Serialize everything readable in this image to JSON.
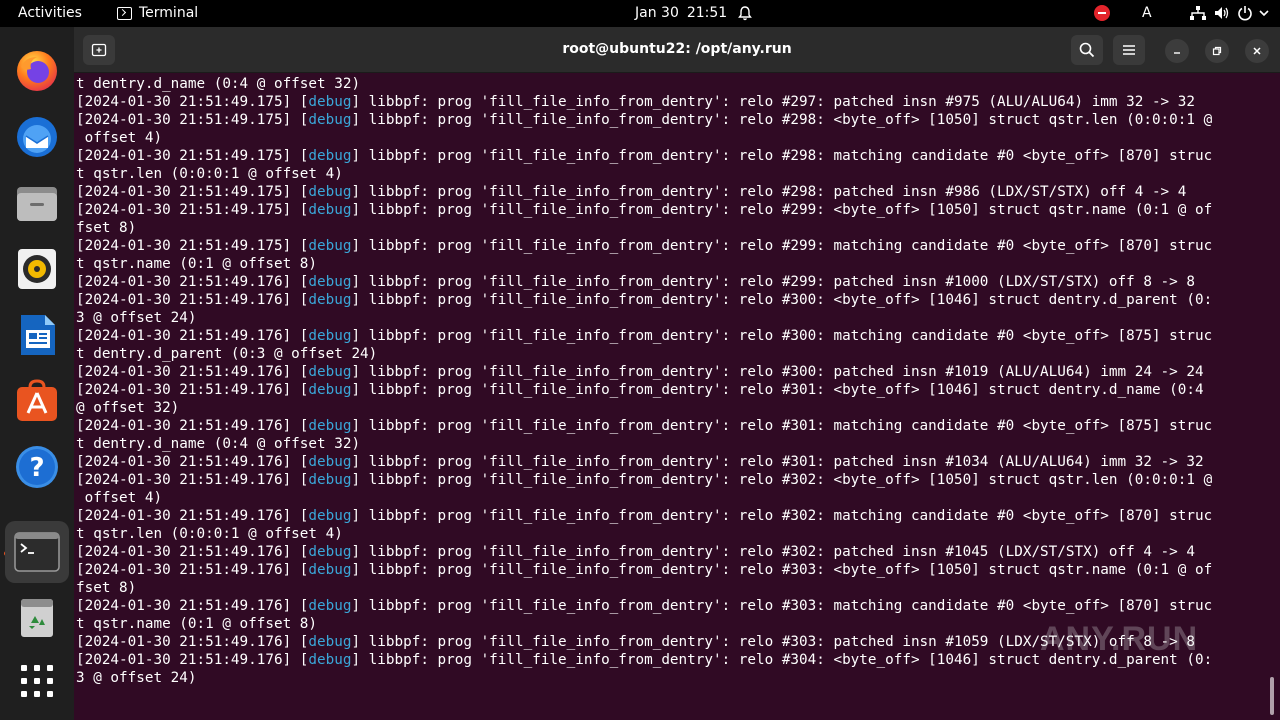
{
  "topbar": {
    "activities": "Activities",
    "app_name": "Terminal",
    "date": "Jan 30",
    "time": "21:51",
    "lang": "A"
  },
  "dock": {
    "items": [
      "firefox",
      "thunderbird",
      "files",
      "rhythmbox",
      "libreoffice-writer",
      "app-center",
      "help",
      "terminal",
      "trash",
      "show-apps"
    ]
  },
  "window": {
    "title": "root@ubuntu22: /opt/any.run"
  },
  "terminal": {
    "lines": [
      {
        "a": "t dentry.d_name (0:4 @ offset 32)"
      },
      {
        "p": "[2024-01-30 21:51:49.175] [",
        "d": "debug",
        "s": "] libbpf: prog 'fill_file_info_from_dentry': relo #297: patched insn #975 (ALU/ALU64) imm 32 -> 32"
      },
      {
        "p": "[2024-01-30 21:51:49.175] [",
        "d": "debug",
        "s": "] libbpf: prog 'fill_file_info_from_dentry': relo #298: <byte_off> [1050] struct qstr.len (0:0:0:1 @"
      },
      {
        "a": " offset 4)"
      },
      {
        "p": "[2024-01-30 21:51:49.175] [",
        "d": "debug",
        "s": "] libbpf: prog 'fill_file_info_from_dentry': relo #298: matching candidate #0 <byte_off> [870] struc"
      },
      {
        "a": "t qstr.len (0:0:0:1 @ offset 4)"
      },
      {
        "p": "[2024-01-30 21:51:49.175] [",
        "d": "debug",
        "s": "] libbpf: prog 'fill_file_info_from_dentry': relo #298: patched insn #986 (LDX/ST/STX) off 4 -> 4"
      },
      {
        "p": "[2024-01-30 21:51:49.175] [",
        "d": "debug",
        "s": "] libbpf: prog 'fill_file_info_from_dentry': relo #299: <byte_off> [1050] struct qstr.name (0:1 @ of"
      },
      {
        "a": "fset 8)"
      },
      {
        "p": "[2024-01-30 21:51:49.175] [",
        "d": "debug",
        "s": "] libbpf: prog 'fill_file_info_from_dentry': relo #299: matching candidate #0 <byte_off> [870] struc"
      },
      {
        "a": "t qstr.name (0:1 @ offset 8)"
      },
      {
        "p": "[2024-01-30 21:51:49.176] [",
        "d": "debug",
        "s": "] libbpf: prog 'fill_file_info_from_dentry': relo #299: patched insn #1000 (LDX/ST/STX) off 8 -> 8"
      },
      {
        "p": "[2024-01-30 21:51:49.176] [",
        "d": "debug",
        "s": "] libbpf: prog 'fill_file_info_from_dentry': relo #300: <byte_off> [1046] struct dentry.d_parent (0:"
      },
      {
        "a": "3 @ offset 24)"
      },
      {
        "p": "[2024-01-30 21:51:49.176] [",
        "d": "debug",
        "s": "] libbpf: prog 'fill_file_info_from_dentry': relo #300: matching candidate #0 <byte_off> [875] struc"
      },
      {
        "a": "t dentry.d_parent (0:3 @ offset 24)"
      },
      {
        "p": "[2024-01-30 21:51:49.176] [",
        "d": "debug",
        "s": "] libbpf: prog 'fill_file_info_from_dentry': relo #300: patched insn #1019 (ALU/ALU64) imm 24 -> 24"
      },
      {
        "p": "[2024-01-30 21:51:49.176] [",
        "d": "debug",
        "s": "] libbpf: prog 'fill_file_info_from_dentry': relo #301: <byte_off> [1046] struct dentry.d_name (0:4"
      },
      {
        "a": "@ offset 32)"
      },
      {
        "p": "[2024-01-30 21:51:49.176] [",
        "d": "debug",
        "s": "] libbpf: prog 'fill_file_info_from_dentry': relo #301: matching candidate #0 <byte_off> [875] struc"
      },
      {
        "a": "t dentry.d_name (0:4 @ offset 32)"
      },
      {
        "p": "[2024-01-30 21:51:49.176] [",
        "d": "debug",
        "s": "] libbpf: prog 'fill_file_info_from_dentry': relo #301: patched insn #1034 (ALU/ALU64) imm 32 -> 32"
      },
      {
        "p": "[2024-01-30 21:51:49.176] [",
        "d": "debug",
        "s": "] libbpf: prog 'fill_file_info_from_dentry': relo #302: <byte_off> [1050] struct qstr.len (0:0:0:1 @"
      },
      {
        "a": " offset 4)"
      },
      {
        "p": "[2024-01-30 21:51:49.176] [",
        "d": "debug",
        "s": "] libbpf: prog 'fill_file_info_from_dentry': relo #302: matching candidate #0 <byte_off> [870] struc"
      },
      {
        "a": "t qstr.len (0:0:0:1 @ offset 4)"
      },
      {
        "p": "[2024-01-30 21:51:49.176] [",
        "d": "debug",
        "s": "] libbpf: prog 'fill_file_info_from_dentry': relo #302: patched insn #1045 (LDX/ST/STX) off 4 -> 4"
      },
      {
        "p": "[2024-01-30 21:51:49.176] [",
        "d": "debug",
        "s": "] libbpf: prog 'fill_file_info_from_dentry': relo #303: <byte_off> [1050] struct qstr.name (0:1 @ of"
      },
      {
        "a": "fset 8)"
      },
      {
        "p": "[2024-01-30 21:51:49.176] [",
        "d": "debug",
        "s": "] libbpf: prog 'fill_file_info_from_dentry': relo #303: matching candidate #0 <byte_off> [870] struc"
      },
      {
        "a": "t qstr.name (0:1 @ offset 8)"
      },
      {
        "p": "[2024-01-30 21:51:49.176] [",
        "d": "debug",
        "s": "] libbpf: prog 'fill_file_info_from_dentry': relo #303: patched insn #1059 (LDX/ST/STX) off 8 -> 8"
      },
      {
        "p": "[2024-01-30 21:51:49.176] [",
        "d": "debug",
        "s": "] libbpf: prog 'fill_file_info_from_dentry': relo #304: <byte_off> [1046] struct dentry.d_parent (0:"
      },
      {
        "a": "3 @ offset 24)"
      }
    ]
  },
  "watermark": {
    "text": "ANY.RUN"
  }
}
